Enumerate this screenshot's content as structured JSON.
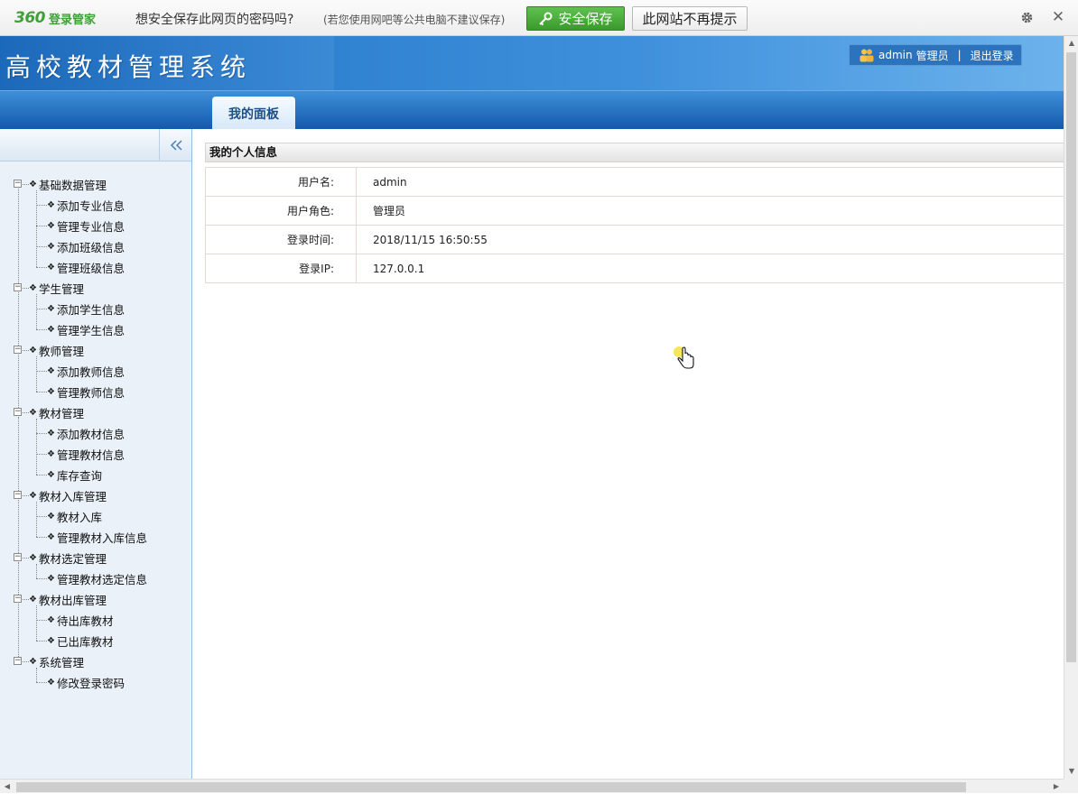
{
  "password_bar": {
    "brand_number": "360",
    "brand_name": "登录管家",
    "question": "想安全保存此网页的密码吗?",
    "hint": "(若您使用网吧等公共电脑不建议保存)",
    "save_label": "安全保存",
    "never_label": "此网站不再提示",
    "close_glyph": "✕"
  },
  "header": {
    "app_title": "高校教材管理系统",
    "user_name": "admin",
    "user_role": "管理员",
    "separator": "|",
    "logout_label": "退出登录"
  },
  "nav": {
    "tabs": [
      {
        "label": "我的面板",
        "active": true
      }
    ]
  },
  "sidebar": {
    "collapse_glyph": "«",
    "groups": [
      {
        "label": "基础数据管理",
        "items": [
          "添加专业信息",
          "管理专业信息",
          "添加班级信息",
          "管理班级信息"
        ]
      },
      {
        "label": "学生管理",
        "items": [
          "添加学生信息",
          "管理学生信息"
        ]
      },
      {
        "label": "教师管理",
        "items": [
          "添加教师信息",
          "管理教师信息"
        ]
      },
      {
        "label": "教材管理",
        "items": [
          "添加教材信息",
          "管理教材信息",
          "库存查询"
        ]
      },
      {
        "label": "教材入库管理",
        "items": [
          "教材入库",
          "管理教材入库信息"
        ]
      },
      {
        "label": "教材选定管理",
        "items": [
          "管理教材选定信息"
        ]
      },
      {
        "label": "教材出库管理",
        "items": [
          "待出库教材",
          "已出库教材"
        ]
      },
      {
        "label": "系统管理",
        "items": [
          "修改登录密码"
        ]
      }
    ]
  },
  "panel": {
    "title": "我的个人信息",
    "rows": [
      {
        "label": "用户名:",
        "value": "admin"
      },
      {
        "label": "用户角色:",
        "value": "管理员"
      },
      {
        "label": "登录时间:",
        "value": "2018/11/15 16:50:55"
      },
      {
        "label": "登录IP:",
        "value": "127.0.0.1"
      }
    ]
  },
  "colors": {
    "brand_green": "#3fa03a",
    "header_blue": "#1b67b8",
    "sidebar_bg": "#eaf1f8"
  }
}
